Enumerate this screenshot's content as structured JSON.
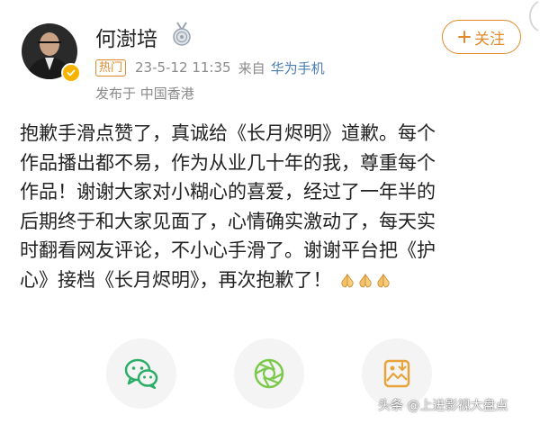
{
  "post": {
    "author": {
      "name": "何澍培",
      "avatar_icon": "avatar-portrait",
      "verified_icon": "verified-badge-icon",
      "medal_icon": "medal-icon"
    },
    "follow_button": {
      "label": "关注",
      "icon": "plus-icon"
    },
    "meta": {
      "badge": "热门",
      "time": "23-5-12 11:35",
      "from_label": "来自",
      "device": "华为手机"
    },
    "location": "发布于 中国香港",
    "content_lines": [
      "抱歉手滑点赞了，真诚给《长月烬明》道歉。每个",
      "作品播出都不易，作为从业几十年的我，尊重每个",
      "作品！谢谢大家对小糊心的喜爱，经过了一年半的",
      "后期终于和大家见面了，心情确实激动了，每天实",
      "时翻看网友评论，不小心手滑了。谢谢平台把《护",
      "心》接档《长月烬明》，再次抱歉了！"
    ],
    "emoji": [
      "folded-hands-emoji",
      "folded-hands-emoji",
      "folded-hands-emoji"
    ]
  },
  "share": {
    "items": [
      {
        "name": "wechat",
        "icon": "wechat-icon",
        "color": "#2aae67"
      },
      {
        "name": "moments",
        "icon": "moments-icon",
        "color": "#7bc94a"
      },
      {
        "name": "save-image",
        "icon": "image-download-icon",
        "color": "#e8a43a"
      }
    ]
  },
  "watermark": "头条 @上进影视大盘点",
  "colors": {
    "accent_orange": "#e08a2c",
    "link_blue": "#4a7db3",
    "meta_gray": "#8a8a8a",
    "text": "#222222"
  }
}
